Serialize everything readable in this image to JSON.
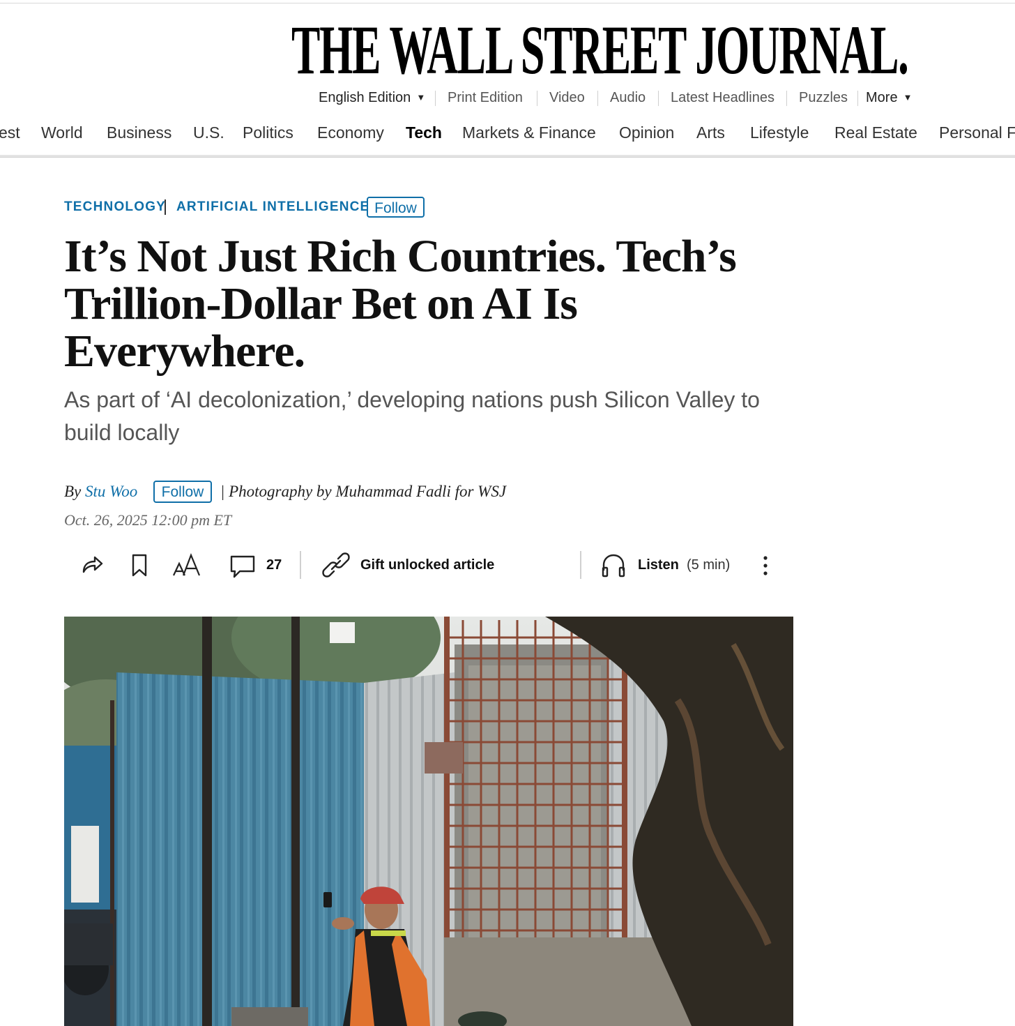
{
  "masthead": {
    "title": "THE WALL STREET JOURNAL."
  },
  "edition_bar": {
    "items": [
      "English Edition",
      "Print Edition",
      "Video",
      "Audio",
      "Latest Headlines",
      "Puzzles",
      "More"
    ]
  },
  "section_nav": {
    "items": [
      "est",
      "World",
      "Business",
      "U.S.",
      "Politics",
      "Economy",
      "Tech",
      "Markets & Finance",
      "Opinion",
      "Arts",
      "Lifestyle",
      "Real Estate",
      "Personal F"
    ],
    "active": "Tech"
  },
  "article": {
    "kicker_primary": "TECHNOLOGY",
    "kicker_secondary": "ARTIFICIAL INTELLIGENCE",
    "follow_label": "Follow",
    "headline": "It’s Not Just Rich Countries. Tech’s Trillion-Dollar Bet on AI Is Everywhere.",
    "dek": "As part of ‘AI decolonization,’ developing nations push Silicon Valley to build locally",
    "byline_prefix": "By",
    "author": "Stu Woo",
    "author_follow_label": "Follow",
    "photo_credit": "| Photography by Muhammad Fadli for WSJ",
    "date": "Oct. 26, 2025 12:00 pm ET"
  },
  "toolbar": {
    "comment_count": "27",
    "gift_label": "Gift unlocked article",
    "listen_label": "Listen",
    "listen_duration": "(5 min)"
  },
  "colors": {
    "accent": "#0f6fa8",
    "text": "#222222",
    "dek": "#555555"
  }
}
